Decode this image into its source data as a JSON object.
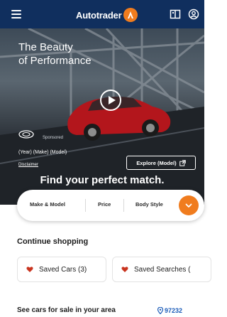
{
  "header": {
    "logo_text": "Autotrader",
    "brand_color": "#102f5e",
    "accent_color": "#f07c1e",
    "icons": [
      "menu-icon",
      "compare-icon",
      "account-icon"
    ]
  },
  "hero": {
    "headline_line1": "The Beauty",
    "headline_line2": "of Performance",
    "sponsored_label": "Sponsored",
    "model_line": "(Year) (Make) (Model)",
    "disclaimer_label": "Disclaimer",
    "explore_label": "Explore (Model)",
    "find_title": "Find your perfect match."
  },
  "search": {
    "tabs": [
      "Make & Model",
      "Price",
      "Body Style"
    ]
  },
  "continue": {
    "title": "Continue shopping",
    "saved_cars": "Saved Cars (3)",
    "saved_searches": "Saved Searches ("
  },
  "nearby": {
    "title": "See cars for sale in your area",
    "zip": "97232"
  }
}
